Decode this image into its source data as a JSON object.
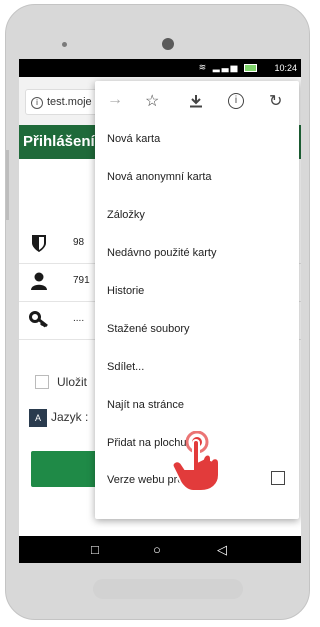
{
  "statusbar": {
    "time": "10:24"
  },
  "browser": {
    "url": "test.moje"
  },
  "page": {
    "header_title": "Přihlášení",
    "rows": [
      {
        "icon": "shield-icon",
        "value": "98"
      },
      {
        "icon": "user-icon",
        "value": "791"
      },
      {
        "icon": "key-icon",
        "value": "...."
      }
    ],
    "remember_label": "Uložit",
    "language_label": "Jazyk :"
  },
  "menu": {
    "toolbar_icons": [
      "forward-icon",
      "star-icon",
      "download-icon",
      "info-icon",
      "reload-icon"
    ],
    "items": [
      "Nová karta",
      "Nová anonymní karta",
      "Záložky",
      "Nedávno použité karty",
      "Historie",
      "Stažené soubory",
      "Sdílet...",
      "Najít na stránce",
      "Přidat na plochu",
      "Verze webu pro P"
    ]
  }
}
